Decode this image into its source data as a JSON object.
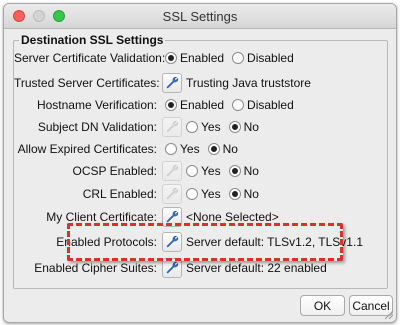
{
  "window": {
    "title": "SSL Settings",
    "group_title": "Destination SSL Settings"
  },
  "rows": {
    "server_cert_validation": {
      "label": "Server Certificate Validation:",
      "opt1": "Enabled",
      "opt2": "Disabled",
      "selected": "Enabled"
    },
    "trusted_server_certs": {
      "label": "Trusted Server Certificates:",
      "value": "Trusting Java truststore"
    },
    "hostname_verification": {
      "label": "Hostname Verification:",
      "opt1": "Enabled",
      "opt2": "Disabled",
      "selected": "Enabled"
    },
    "subject_dn_validation": {
      "label": "Subject DN Validation:",
      "opt1": "Yes",
      "opt2": "No",
      "selected": "No"
    },
    "allow_expired_certs": {
      "label": "Allow Expired Certificates:",
      "opt1": "Yes",
      "opt2": "No",
      "selected": "No"
    },
    "ocsp_enabled": {
      "label": "OCSP Enabled:",
      "opt1": "Yes",
      "opt2": "No",
      "selected": "No"
    },
    "crl_enabled": {
      "label": "CRL Enabled:",
      "opt1": "Yes",
      "opt2": "No",
      "selected": "No"
    },
    "my_client_cert": {
      "label": "My Client Certificate:",
      "value": "<None Selected>"
    },
    "enabled_protocols": {
      "label": "Enabled Protocols:",
      "value": "Server default: TLSv1.2, TLSv1.1"
    },
    "enabled_cipher_suites": {
      "label": "Enabled Cipher Suites:",
      "value": "Server default: 22 enabled"
    }
  },
  "buttons": {
    "ok": "OK",
    "cancel": "Cancel"
  },
  "icons": {
    "edit": "wrench-icon"
  },
  "colors": {
    "highlight": "#d9322e",
    "close": "#fc605c",
    "zoom": "#34c84a"
  }
}
